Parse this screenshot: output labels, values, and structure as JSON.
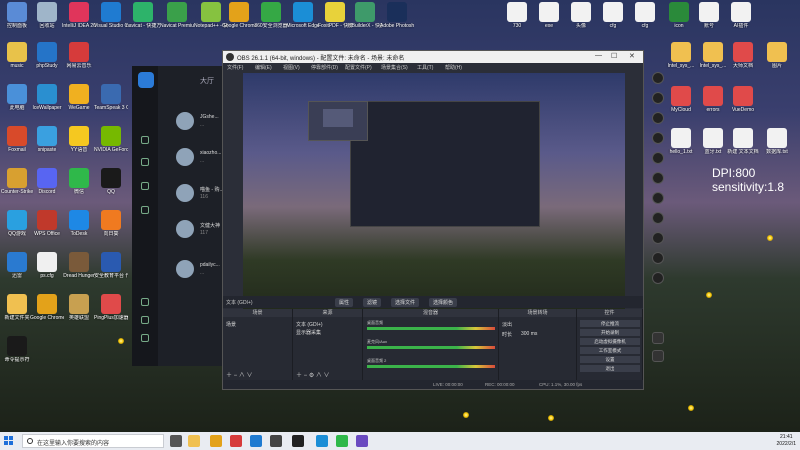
{
  "desktop": {
    "left_icons": [
      {
        "label": "控制面板",
        "color": "#5a8bd6"
      },
      {
        "label": "回收站",
        "color": "#9fb5c9"
      },
      {
        "label": "IntelliJ IDEA 2021.2.1",
        "color": "#e0355b"
      },
      {
        "label": "Visual Studio Code",
        "color": "#1f7bd1"
      },
      {
        "label": "navicat - 快捷方式",
        "color": "#2db36a"
      },
      {
        "label": "Navicat Premium 11",
        "color": "#3aa04a"
      },
      {
        "label": "Notepad++ - 快捷方式",
        "color": "#86c240"
      },
      {
        "label": "Google Chrome",
        "color": "#e3a21a"
      },
      {
        "label": "360安全浏览器",
        "color": "#35a845"
      },
      {
        "label": "Microsoft Edge",
        "color": "#1b8ed6"
      },
      {
        "label": "FoxitPDF - 快捷方式",
        "color": "#e8d23a"
      },
      {
        "label": "HBuilderX - 快捷方式",
        "color": "#3e9a6a"
      },
      {
        "label": "Adobe Photosh...",
        "color": "#1a2f5a"
      },
      {
        "label": "music",
        "color": "#e8c24a"
      },
      {
        "label": "phpStudy",
        "color": "#2574c8"
      },
      {
        "label": "网易云音乐",
        "color": "#d63b3b"
      },
      {
        "label": "此电脑",
        "color": "#4a90d9"
      },
      {
        "label": "IceWallpaper",
        "color": "#2a8fd0"
      },
      {
        "label": "WeGame",
        "color": "#f0b020"
      },
      {
        "label": "TeamSpeak 3 Client",
        "color": "#3a6ab0"
      },
      {
        "label": "Foxmail",
        "color": "#d84a2a"
      },
      {
        "label": "snipaste",
        "color": "#3aa0e0"
      },
      {
        "label": "YY语音",
        "color": "#f5c820"
      },
      {
        "label": "NVIDIA GeForce",
        "color": "#76b900"
      },
      {
        "label": "Counter-Strike",
        "color": "#d8a030"
      },
      {
        "label": "Discord",
        "color": "#5865f2"
      },
      {
        "label": "微信",
        "color": "#2fb84a"
      },
      {
        "label": "QQ",
        "color": "#1a1a1a"
      },
      {
        "label": "QQ游戏",
        "color": "#2aa0e0"
      },
      {
        "label": "WPS Office",
        "color": "#c0392b"
      },
      {
        "label": "ToDesk",
        "color": "#1e88e5"
      },
      {
        "label": "向日葵",
        "color": "#f07a20"
      },
      {
        "label": "迅雷",
        "color": "#2a7ad0"
      },
      {
        "label": "ps.cfg",
        "color": "#f0f0f0"
      },
      {
        "label": "Dread Hunger",
        "color": "#7a5a3a"
      },
      {
        "label": "安全教育平台 作业 文档",
        "color": "#2a5ab0"
      },
      {
        "label": "新建文件夹",
        "color": "#f0c050"
      },
      {
        "label": "Google Chrome",
        "color": "#e3a21a"
      },
      {
        "label": "英雄联盟",
        "color": "#c8a050"
      },
      {
        "label": "PingPlus加速器",
        "color": "#e04a4a"
      },
      {
        "label": "命令提示符",
        "color": "#1a1a1a"
      }
    ],
    "right_icons": [
      {
        "label": "730",
        "color": "#f2f2f2"
      },
      {
        "label": "exe",
        "color": "#f2f2f2"
      },
      {
        "label": "头像",
        "color": "#f2f2f2"
      },
      {
        "label": "cfg",
        "color": "#f2f2f2"
      },
      {
        "label": "cfg",
        "color": "#f2f2f2"
      },
      {
        "label": "icon",
        "color": "#2a8a3a"
      },
      {
        "label": "账号",
        "color": "#f2f2f2"
      },
      {
        "label": "AI插件",
        "color": "#f2f2f2"
      },
      {
        "label": "Intel_sys_...",
        "color": "#f0c050"
      },
      {
        "label": "Intel_sys_...",
        "color": "#f0c050"
      },
      {
        "label": "大师文档",
        "color": "#e04a4a"
      },
      {
        "label": "图片",
        "color": "#f0c050"
      },
      {
        "label": "MyCloud",
        "color": "#e04a4a"
      },
      {
        "label": "errors",
        "color": "#e04a4a"
      },
      {
        "label": "VueDemo",
        "color": "#e04a4a"
      },
      {
        "label": "hello_1.txt",
        "color": "#f2f2f2"
      },
      {
        "label": "蓝牙.txt",
        "color": "#f2f2f2"
      },
      {
        "label": "新建 文本文档",
        "color": "#f2f2f2"
      },
      {
        "label": "数据库.txt",
        "color": "#f2f2f2"
      }
    ],
    "overlay_text": [
      "DPI:800",
      "sensitivity:1.8"
    ]
  },
  "chat_app": {
    "title": "大厅",
    "contacts": [
      {
        "name": "JGshe...",
        "preview": "..."
      },
      {
        "name": "xiaozho...",
        "preview": "..."
      },
      {
        "name": "喵鱼 - 购...",
        "preview": "116"
      },
      {
        "name": "文健大神",
        "preview": "117"
      },
      {
        "name": "pdailyc...",
        "preview": "..."
      }
    ]
  },
  "obs": {
    "title": "OBS 26.1.1 (64-bit, windows) - 配置文件: 未命名 - 场景: 未命名",
    "menu": [
      "文件(F)",
      "编辑(E)",
      "视图(V)",
      "停靠部件(D)",
      "配置文件(P)",
      "场景集合(S)",
      "工具(T)",
      "帮助(H)"
    ],
    "source_name": "文本 (GDI+)",
    "scene_buttons": [
      "属性",
      "滤镜",
      "选择文件",
      "选择颜色"
    ],
    "docks": {
      "scenes": {
        "header": "场景",
        "items": [
          "场景"
        ]
      },
      "sources": {
        "header": "来源",
        "items": [
          "文本 (GDI+)",
          "显示器采集"
        ]
      },
      "mixer": {
        "header": "混音器",
        "channels": [
          {
            "name": "桌面音频",
            "db": "0.0 dB"
          },
          {
            "name": "麦克风/Aux",
            "db": "0.0 dB"
          },
          {
            "name": "桌面音频 2",
            "db": "0.0 dB"
          }
        ]
      },
      "transitions": {
        "header": "场景转场",
        "type": "淡出",
        "duration_label": "时长",
        "duration": "300 ms"
      },
      "controls": {
        "header": "控件",
        "buttons": [
          "停止推流",
          "开始录制",
          "启动虚拟摄像机",
          "工作室模式",
          "设置",
          "退出"
        ]
      }
    },
    "status": [
      "LIVE: 00:00:00",
      "REC: 00:00:00",
      "CPU: 1.1%, 30.00 fps"
    ]
  },
  "taskbar": {
    "search_placeholder": "在这里输入你要搜索的内容",
    "time": "21:41",
    "date": "2022/2/1",
    "apps": [
      {
        "name": "task-view-icon",
        "color": "#555"
      },
      {
        "name": "file-explorer-icon",
        "color": "#f0c050"
      },
      {
        "name": "chrome-icon",
        "color": "#e3a21a"
      },
      {
        "name": "netease-music-icon",
        "color": "#d63b3b"
      },
      {
        "name": "vscode-icon",
        "color": "#1f7bd1"
      },
      {
        "name": "typora-icon",
        "color": "#444"
      },
      {
        "name": "obs-icon",
        "color": "#222"
      },
      {
        "name": "edge-icon",
        "color": "#1b8ed6"
      },
      {
        "name": "wechat-icon",
        "color": "#2fb84a"
      },
      {
        "name": "other-icon",
        "color": "#6a4ac0"
      }
    ]
  }
}
